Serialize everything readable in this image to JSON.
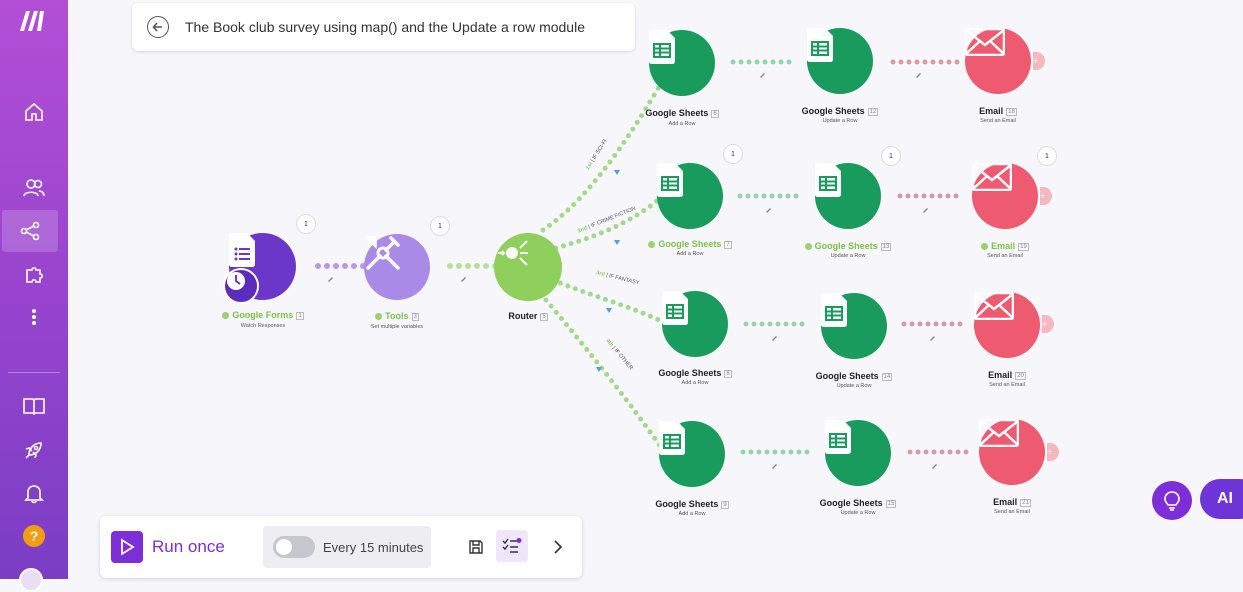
{
  "title": "The Book club survey using map() and the Update a row module",
  "sidebar": {
    "items": [
      {
        "icon": "logo-icon"
      },
      {
        "icon": "home-icon"
      },
      {
        "icon": "team-icon"
      },
      {
        "icon": "scenarios-icon",
        "active": true
      },
      {
        "icon": "apps-puzzle-icon"
      },
      {
        "icon": "more-vertical-icon"
      },
      {
        "icon": "docs-book-icon"
      },
      {
        "icon": "rocket-icon"
      },
      {
        "icon": "notifications-bell-icon"
      },
      {
        "icon": "help-icon",
        "label": "?"
      }
    ]
  },
  "modules": {
    "forms": {
      "name": "Google Forms",
      "id": "1",
      "sub": "Watch Responses",
      "badge": "1"
    },
    "tools": {
      "name": "Tools",
      "id": "3",
      "sub": "Set multiple variables",
      "badge": "1"
    },
    "router": {
      "name": "Router",
      "id": "5",
      "sub": ""
    },
    "r1": [
      {
        "name": "Google Sheets",
        "id": "6",
        "sub": "Add a Row"
      },
      {
        "name": "Google Sheets",
        "id": "12",
        "sub": "Update a Row"
      },
      {
        "name": "Email",
        "id": "18",
        "sub": "Send an Email"
      }
    ],
    "r2": [
      {
        "name": "Google Sheets",
        "id": "7",
        "sub": "Add a Row",
        "badge": "1"
      },
      {
        "name": "Google Sheets",
        "id": "13",
        "sub": "Update a Row",
        "badge": "1"
      },
      {
        "name": "Email",
        "id": "19",
        "sub": "Send an Email",
        "badge": "1"
      }
    ],
    "r3": [
      {
        "name": "Google Sheets",
        "id": "8",
        "sub": "Add a Row"
      },
      {
        "name": "Google Sheets",
        "id": "14",
        "sub": "Update a Row"
      },
      {
        "name": "Email",
        "id": "20",
        "sub": "Send an Email"
      }
    ],
    "r4": [
      {
        "name": "Google Sheets",
        "id": "9",
        "sub": "Add a Row"
      },
      {
        "name": "Google Sheets",
        "id": "15",
        "sub": "Update a Row"
      },
      {
        "name": "Email",
        "id": "21",
        "sub": "Send an Email"
      }
    ]
  },
  "filters": [
    {
      "order": "1st",
      "label": "IF SCI-FI"
    },
    {
      "order": "2nd",
      "label": "IF CRIME FICTION"
    },
    {
      "order": "3rd",
      "label": "IF FANTASY"
    },
    {
      "order": "4th",
      "label": "IF OTHER"
    }
  ],
  "bottom_bar": {
    "run_label": "Run once",
    "schedule_label": "Every 15 minutes"
  },
  "ai_label": "AI",
  "colors": {
    "sheets": "#1a9b5e",
    "email": "#ee5a6f",
    "router": "#8fcf5c",
    "tools": "#a98ae6",
    "forms": "#6b37c9",
    "accent": "#7d2ed8"
  }
}
